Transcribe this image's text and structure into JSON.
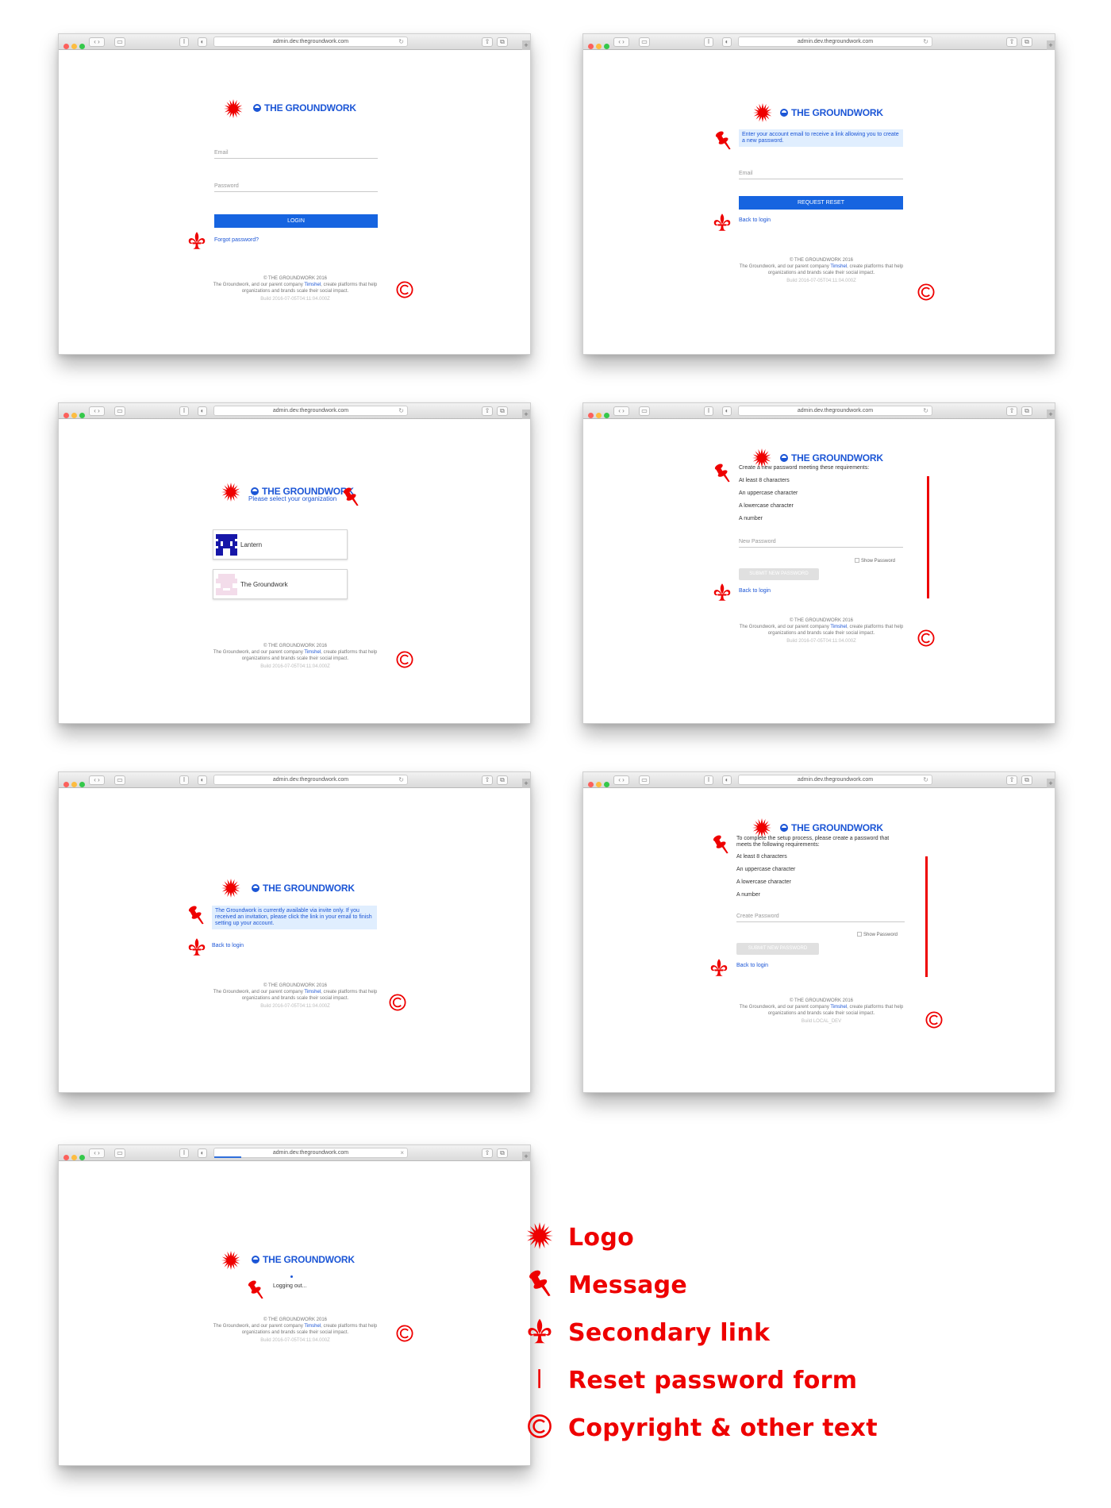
{
  "url": "admin.dev.thegroundwork.com",
  "brand": "THE GROUNDWORK",
  "footer": {
    "copyright": "© THE GROUNDWORK 2016",
    "text_pre": "The Groundwork, and our parent company ",
    "company": "Timshel",
    "text_post": ", create platforms that help organizations and brands scale their social impact.",
    "build": "Build 2016-07-05T04:11:04.000Z",
    "build_local": "Build LOCAL_DEV"
  },
  "login": {
    "email_label": "Email",
    "password_label": "Password",
    "login_button": "LOGIN",
    "forgot_link": "Forgot password?"
  },
  "reset_request": {
    "message": "Enter your account email to receive a link allowing you to create a new password.",
    "email_label": "Email",
    "button": "REQUEST RESET",
    "back_link": "Back to login"
  },
  "org_select": {
    "subtitle": "Please select your organization",
    "orgs": [
      "Lantern",
      "The Groundwork"
    ]
  },
  "new_password": {
    "heading": "Create a new password meeting these requirements:",
    "requirements": [
      "At least 8 characters",
      "An uppercase character",
      "A lowercase character",
      "A number"
    ],
    "field_label": "New Password",
    "show_password": "Show Password",
    "button": "SUBMIT NEW PASSWORD",
    "back_link": "Back to login"
  },
  "invite_only": {
    "message": "The Groundwork is currently available via invite only. If you received an invitation, please click the link in your email to finish setting up your account.",
    "back_link": "Back to login"
  },
  "setup_password": {
    "heading": "To complete the setup process, please create a password that meets the following requirements:",
    "requirements": [
      "At least 8 characters",
      "An uppercase character",
      "A lowercase character",
      "A number"
    ],
    "field_label": "Create Password",
    "show_password": "Show Password",
    "button": "SUBMIT NEW PASSWORD",
    "back_link": "Back to login"
  },
  "logout": {
    "message": "Logging out..."
  },
  "legend": {
    "logo": "Logo",
    "message": "Message",
    "secondary_link": "Secondary link",
    "reset_form": "Reset password form",
    "copyright": "Copyright & other text"
  },
  "colors": {
    "annotation": "#ee0000",
    "brand_blue": "#1c56d6",
    "button_blue": "#1664e0",
    "message_bg": "#e0eefe"
  },
  "icons": {
    "logo": "starburst-icon",
    "message": "pushpin-icon",
    "secondary_link": "fleur-de-lis-icon",
    "reset_form": "vertical-bar-icon",
    "copyright": "copyright-icon"
  }
}
